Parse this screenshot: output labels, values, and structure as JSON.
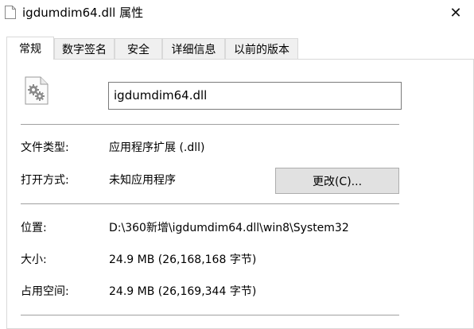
{
  "window": {
    "title": "igdumdim64.dll 属性",
    "close_glyph": "✕",
    "icons": [
      "file-icon",
      "close-icon"
    ]
  },
  "tabs": [
    {
      "label": "常规",
      "active": true
    },
    {
      "label": "数字签名",
      "active": false
    },
    {
      "label": "安全",
      "active": false
    },
    {
      "label": "详细信息",
      "active": false
    },
    {
      "label": "以前的版本",
      "active": false
    }
  ],
  "general": {
    "file_name": "igdumdim64.dll",
    "file_icon": "gear-file-icon",
    "type_label": "文件类型:",
    "type_value": "应用程序扩展 (.dll)",
    "opens_with_label": "打开方式:",
    "opens_with_value": "未知应用程序",
    "change_button": "更改(C)...",
    "location_label": "位置:",
    "location_value": "D:\\360新增\\igdumdim64.dll\\win8\\System32",
    "size_label": "大小:",
    "size_value": "24.9 MB (26,168,168 字节)",
    "size_on_disk_label": "占用空间:",
    "size_on_disk_value": "24.9 MB (26,169,344 字节)"
  }
}
